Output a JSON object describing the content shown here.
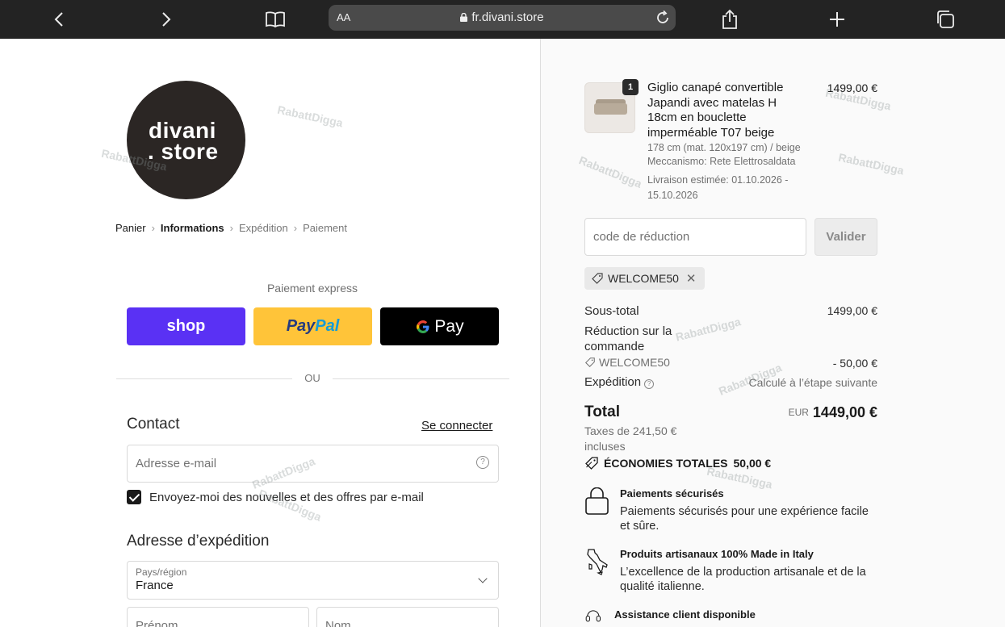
{
  "browser": {
    "aa_label": "AA",
    "url": "fr.divani.store"
  },
  "logo": {
    "line1": "divani",
    "line2": ". store"
  },
  "breadcrumb": {
    "items": [
      "Panier",
      "Informations",
      "Expédition",
      "Paiement"
    ]
  },
  "express": {
    "title": "Paiement express",
    "shop_label": "shop",
    "paypal_part1": "Pay",
    "paypal_part2": "Pal",
    "gpay_g": "G",
    "gpay_label": "Pay",
    "or_label": "OU"
  },
  "contact": {
    "title": "Contact",
    "login_link": "Se connecter",
    "email_placeholder": "Adresse e-mail",
    "help_icon_text": "?",
    "newsletter_label": "Envoyez-moi des nouvelles et des offres par e-mail",
    "newsletter_checked": true
  },
  "shipping": {
    "title": "Adresse d’expédition",
    "country_label": "Pays/région",
    "country_value": "France",
    "first_name_placeholder": "Prénom",
    "last_name_placeholder": "Nom"
  },
  "order": {
    "quantity": "1",
    "product_name": "Giglio canapé convertible Japandi avec matelas H 18cm en bouclette imperméable T07 beige",
    "variant": "178 cm (mat. 120x197 cm) / beige",
    "mechanism": "Meccanismo: Rete Elettrosaldata",
    "delivery": "Livraison estimée: 01.10.2026 - 15.10.2026",
    "price": "1499,00 €"
  },
  "discount": {
    "placeholder": "code de réduction",
    "apply_label": "Valider",
    "applied_code": "WELCOME50"
  },
  "summary": {
    "subtotal_label": "Sous-total",
    "subtotal_value": "1499,00 €",
    "reduction_label": "Réduction sur la commande",
    "reduction_code": "WELCOME50",
    "reduction_value": "- 50,00 €",
    "shipping_label": "Expédition",
    "shipping_value": "Calculé à l’étape suivante",
    "total_label": "Total",
    "currency": "EUR",
    "total_value": "1449,00 €",
    "taxes_note": "Taxes de 241,50 € incluses",
    "savings_label": "ÉCONOMIES TOTALES",
    "savings_value": "50,00 €"
  },
  "features": [
    {
      "icon": "bag-lock-icon",
      "title": "Paiements sécurisés",
      "desc": "Paiements sécurisés pour une expérience facile et sûre."
    },
    {
      "icon": "italy-map-icon",
      "title": "Produits artisanaux 100% Made in Italy",
      "desc": "L’excellence de la production artisanale et de la qualité italienne."
    },
    {
      "icon": "headset-icon",
      "title": "Assistance client disponible",
      "desc": ""
    }
  ],
  "watermark_text": "RabattDigga",
  "colors": {
    "shop": "#5a31f4",
    "paypal": "#ffc439",
    "gpay": "#000000",
    "logo_bg": "#2b2624"
  }
}
